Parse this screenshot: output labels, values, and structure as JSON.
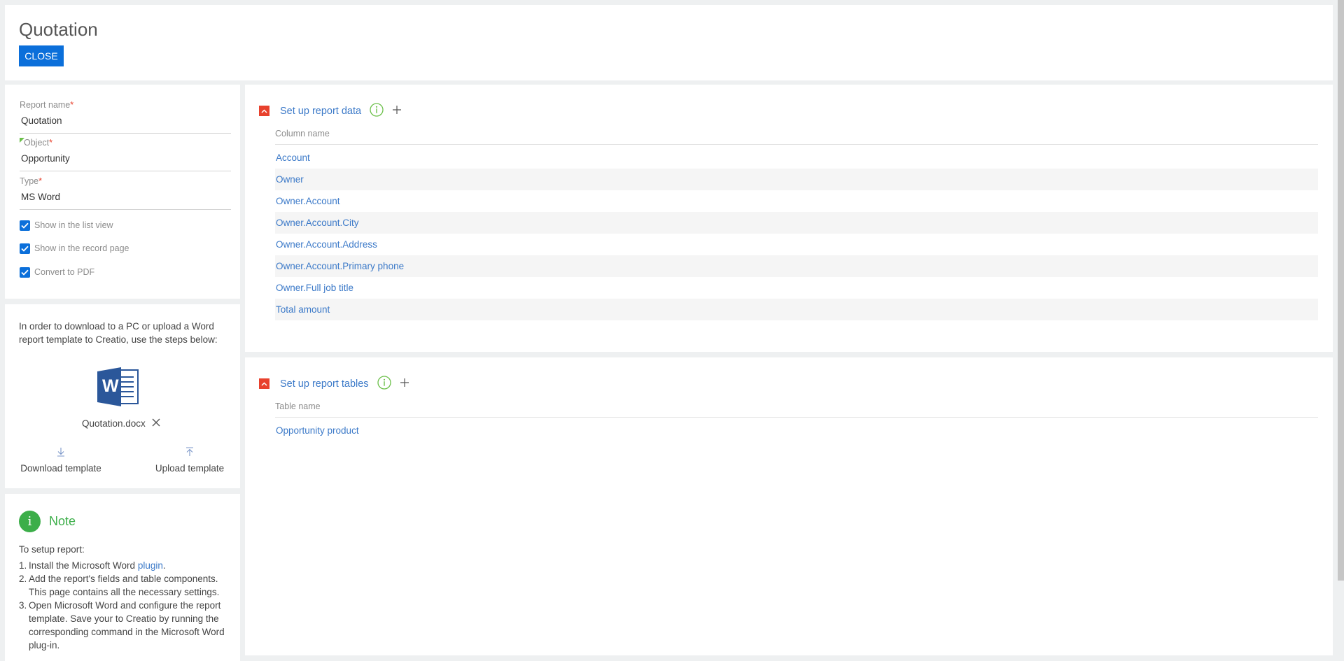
{
  "header": {
    "title": "Quotation",
    "close_label": "CLOSE"
  },
  "properties": {
    "report_name": {
      "label": "Report name",
      "required": "*",
      "value": "Quotation"
    },
    "object": {
      "label": "Object",
      "required": "*",
      "value": "Opportunity"
    },
    "type": {
      "label": "Type",
      "required": "*",
      "value": "MS Word"
    },
    "checks": [
      {
        "label": "Show in the list view",
        "checked": true
      },
      {
        "label": "Show in the record page",
        "checked": true
      },
      {
        "label": "Convert to PDF",
        "checked": true
      }
    ]
  },
  "template": {
    "text": "In order to download to a PC or upload a Word report template to Creatio, use the steps below:",
    "icon_letter": "W",
    "filename": "Quotation.docx",
    "download_label": "Download template",
    "upload_label": "Upload template"
  },
  "note": {
    "title": "Note",
    "icon_letter": "i",
    "intro": "To setup report:",
    "items": [
      {
        "n": "1.",
        "text": "Install the Microsoft Word ",
        "link": "plugin",
        "after": "."
      },
      {
        "n": "2.",
        "text": "Add the report's fields and table components. This page contains all the necessary settings."
      },
      {
        "n": "3.",
        "text": "Open Microsoft Word and configure the report template. Save your to Creatio by running the corresponding command in the Microsoft Word plug-in."
      }
    ]
  },
  "report_data": {
    "title": "Set up report data",
    "column_header": "Column name",
    "rows": [
      "Account",
      "Owner",
      "Owner.Account",
      "Owner.Account.City",
      "Owner.Account.Address",
      "Owner.Account.Primary phone",
      "Owner.Full job title",
      "Total amount"
    ]
  },
  "report_tables": {
    "title": "Set up report tables",
    "column_header": "Table name",
    "rows": [
      "Opportunity product"
    ]
  },
  "colors": {
    "accent": "#0b6fda",
    "link": "#3b79c8",
    "danger": "#e8412d",
    "success": "#3cae49"
  }
}
